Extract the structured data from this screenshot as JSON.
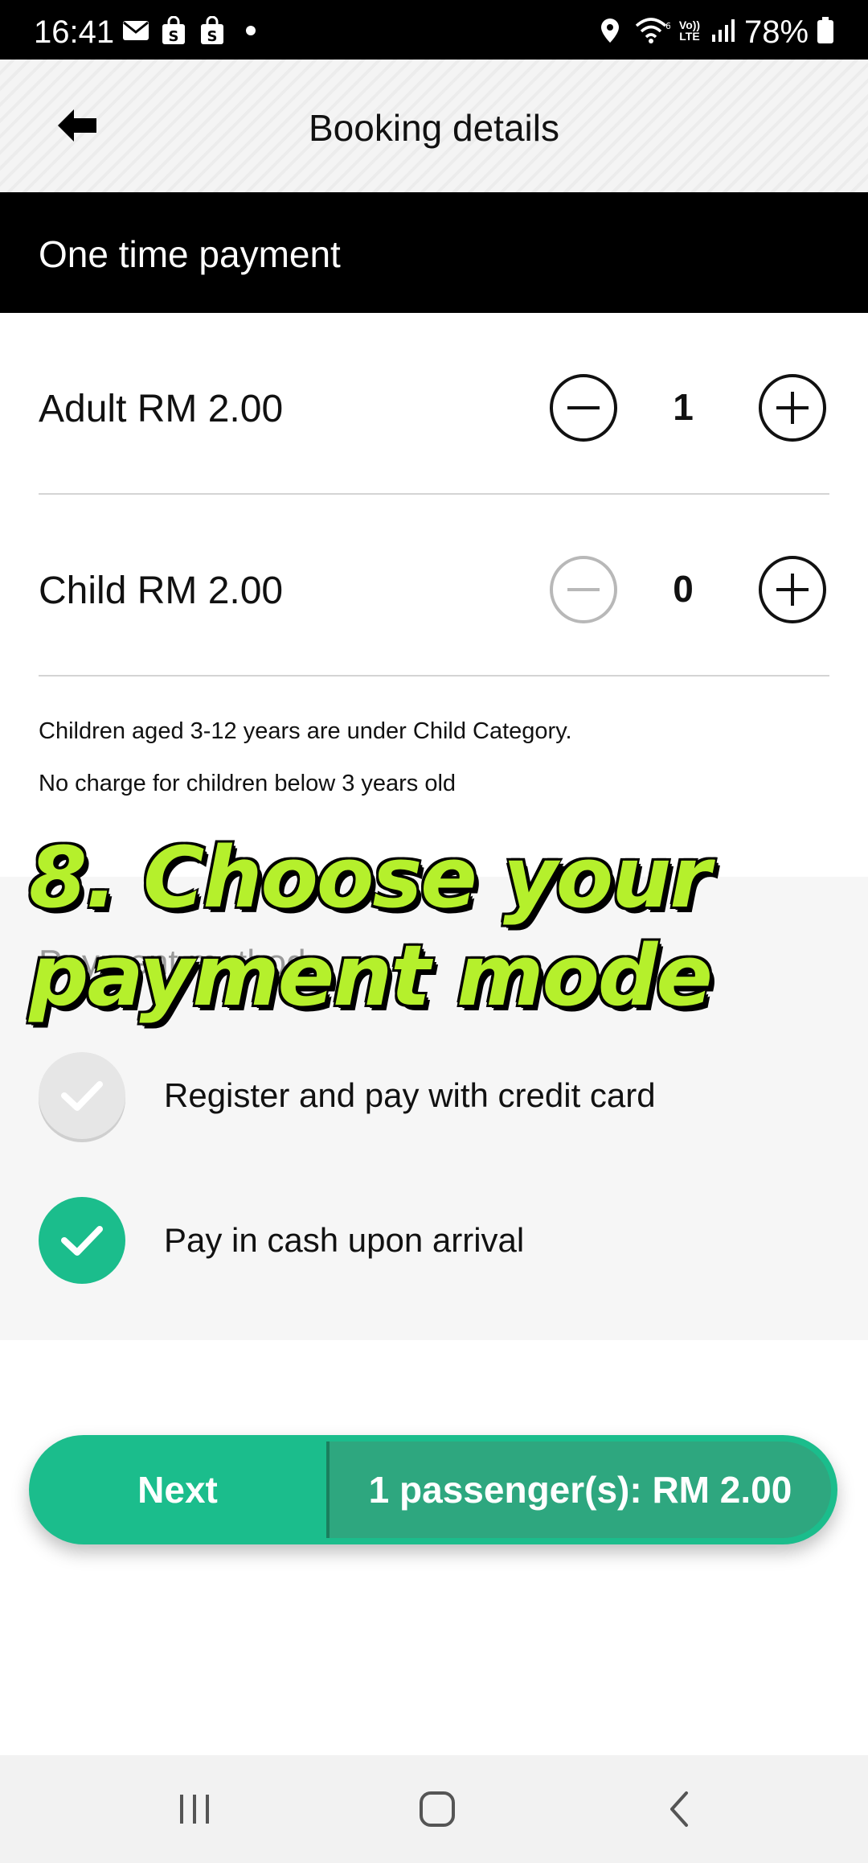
{
  "status_bar": {
    "time": "16:41",
    "battery": "78%",
    "icons": [
      "mail-icon",
      "shopping-bag-icon",
      "shopping-bag-icon",
      "dot-icon",
      "location-icon",
      "wifi-icon",
      "volte-icon",
      "signal-icon",
      "battery-icon"
    ],
    "volte_text": "Vo)) LTE"
  },
  "app_bar": {
    "title": "Booking details",
    "back_icon": "arrow-left-icon"
  },
  "section_header": "One time payment",
  "fares": [
    {
      "label": "Adult RM 2.00",
      "count": "1",
      "minus_enabled": true
    },
    {
      "label": "Child RM 2.00",
      "count": "0",
      "minus_enabled": false
    }
  ],
  "notes": [
    "Children aged 3-12 years are under Child Category.",
    "No charge for children below 3 years old"
  ],
  "payment": {
    "title": "Payment method",
    "options": [
      {
        "label": "Register and pay with credit card",
        "selected": false
      },
      {
        "label": "Pay in cash upon arrival",
        "selected": true
      }
    ]
  },
  "overlay_caption": "8. Choose your\npayment mode",
  "next_button": {
    "label": "Next",
    "summary": "1 passenger(s):  RM 2.00"
  },
  "colors": {
    "accent": "#1bbd8c",
    "accent_dark": "#2ea77f",
    "caption": "#b5f02c"
  }
}
